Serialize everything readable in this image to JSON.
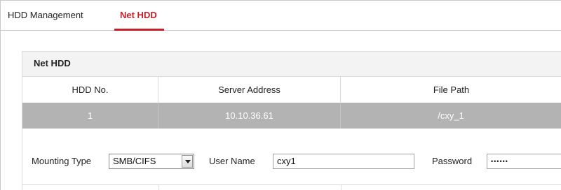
{
  "tabs": [
    {
      "label": "HDD Management",
      "active": false
    },
    {
      "label": "Net HDD",
      "active": true
    }
  ],
  "accent_color": "#c8202a",
  "section": {
    "title": "Net HDD"
  },
  "table": {
    "columns": [
      "HDD No.",
      "Server Address",
      "File Path"
    ],
    "rows": [
      [
        "1",
        "10.10.36.61",
        "/cxy_1"
      ]
    ],
    "selected_row_color": "#b3b3b3"
  },
  "form": {
    "mounting_type_label": "Mounting Type",
    "mounting_type_value": "SMB/CIFS",
    "user_name_label": "User Name",
    "user_name_value": "cxy1",
    "password_label": "Password",
    "password_value": "••••••"
  }
}
